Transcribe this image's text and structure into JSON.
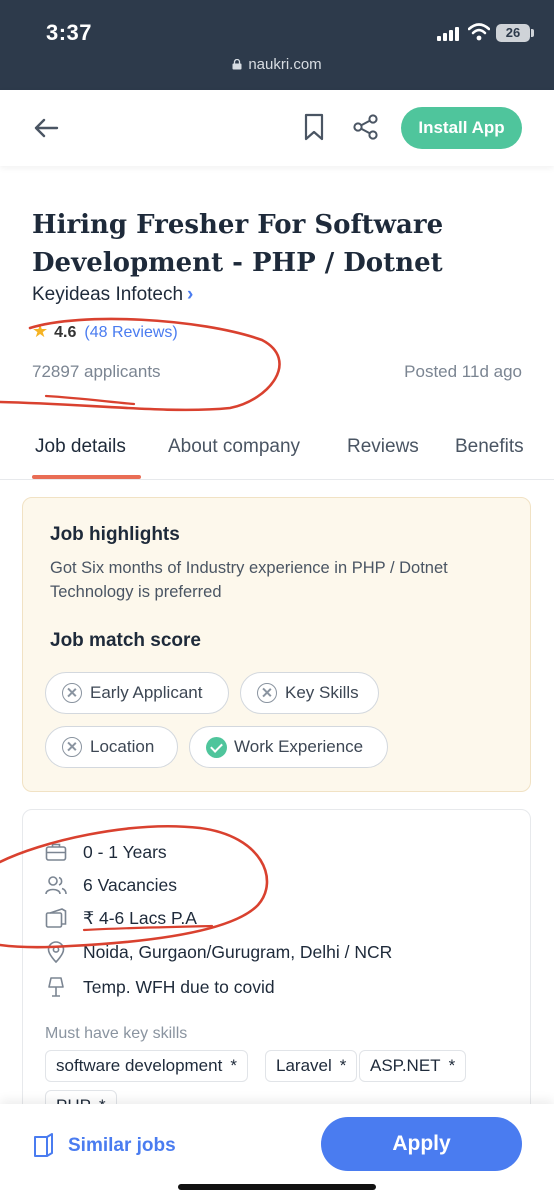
{
  "status": {
    "time": "3:37",
    "battery": "26",
    "url": "naukri.com"
  },
  "header": {
    "install_label": "Install App"
  },
  "job": {
    "title": "Hiring Fresher For Software Development - PHP / Dotnet",
    "company": "Keyideas Infotech",
    "company_chevron": "›",
    "rating": "4.6",
    "reviews": "(48 Reviews)",
    "applicants": "72897 applicants",
    "posted": "Posted 11d ago"
  },
  "tabs": [
    {
      "label": "Job details",
      "active": true
    },
    {
      "label": "About company"
    },
    {
      "label": "Reviews"
    },
    {
      "label": "Benefits"
    }
  ],
  "highlights": {
    "title": "Job highlights",
    "text": "Got Six months of Industry experience in PHP / Dotnet Technology is preferred",
    "match_title": "Job match score",
    "chips": [
      {
        "label": "Early Applicant",
        "matched": false
      },
      {
        "label": "Key Skills",
        "matched": false
      },
      {
        "label": "Location",
        "matched": false
      },
      {
        "label": "Work Experience",
        "matched": true
      }
    ]
  },
  "details": {
    "experience": "0 - 1 Years",
    "vacancies": "6 Vacancies",
    "salary": "₹ 4-6 Lacs P.A",
    "location": "Noida, Gurgaon/Gurugram, Delhi / NCR",
    "wfh": "Temp. WFH due to covid",
    "skills_label": "Must have key skills",
    "skills": [
      "software development",
      "Laravel",
      "ASP.NET",
      "PHP"
    ],
    "skill_marker": "*"
  },
  "footer": {
    "similar_label": "Similar jobs",
    "apply_label": "Apply"
  },
  "colors": {
    "accent": "#4a7cf0",
    "install": "#4fc59c",
    "tab_underline": "#e96d55",
    "annotation": "#d9412f"
  },
  "icons": [
    "back-arrow-icon",
    "bookmark-icon",
    "share-icon",
    "star-icon",
    "briefcase-icon",
    "people-icon",
    "wallet-icon",
    "location-pin-icon",
    "home-office-icon",
    "similar-jobs-icon"
  ]
}
